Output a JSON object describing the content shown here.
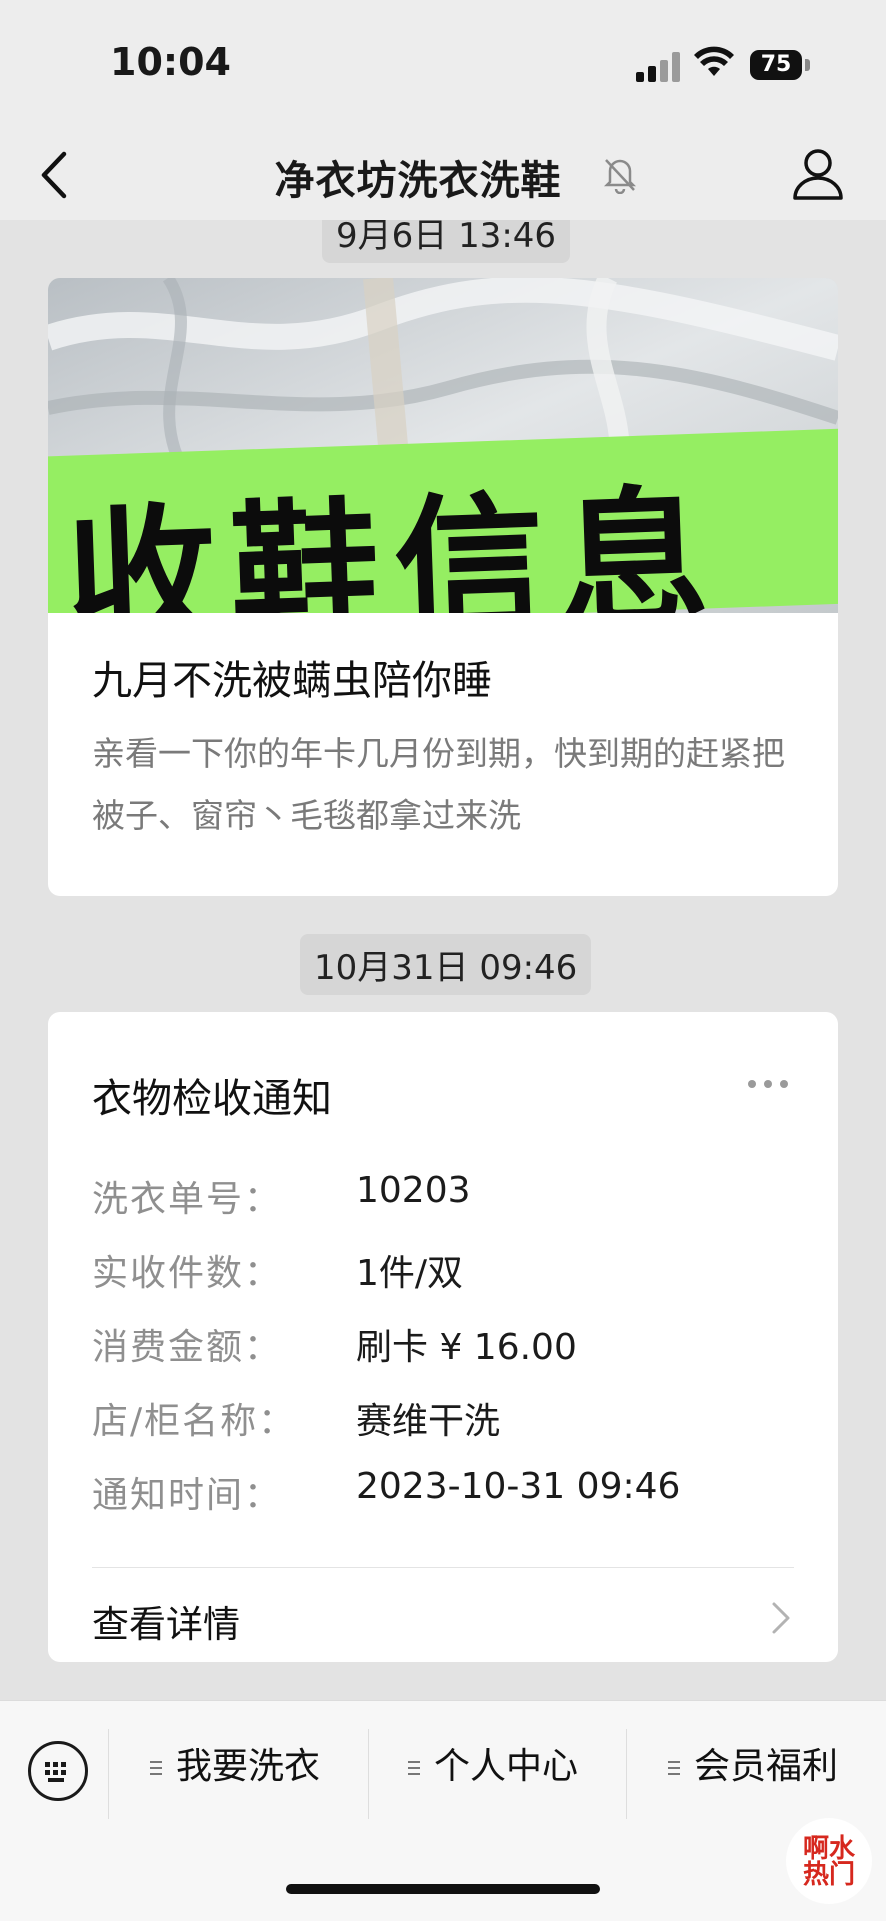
{
  "status_bar": {
    "time": "10:04",
    "battery": "75"
  },
  "nav": {
    "title": "净衣坊洗衣洗鞋"
  },
  "chat": {
    "messages": [
      {
        "timestamp": "9月6日 13:46",
        "cover_text": "收鞋信息",
        "title": "九月不洗被螨虫陪你睡",
        "description": "亲看一下你的年卡几月份到期，快到期的赶紧把被子、窗帘丶毛毯都拿过来洗"
      },
      {
        "timestamp": "10月31日 09:46",
        "title": "衣物检收通知",
        "fields": [
          {
            "label": "洗衣单号：",
            "value": "10203"
          },
          {
            "label": "实收件数：",
            "value": "1件/双"
          },
          {
            "label": "消费金额：",
            "value": "刷卡 ¥ 16.00"
          },
          {
            "label": "店/柜名称：",
            "value": "赛维干洗"
          },
          {
            "label": "通知时间：",
            "value": "2023-10-31 09:46"
          }
        ],
        "detail_link": "查看详情"
      }
    ]
  },
  "bottom_menu": {
    "items": [
      {
        "label": "我要洗衣"
      },
      {
        "label": "个人中心"
      },
      {
        "label": "会员福利"
      }
    ]
  },
  "watermark": {
    "line1": "啊水",
    "line2": "热门"
  }
}
